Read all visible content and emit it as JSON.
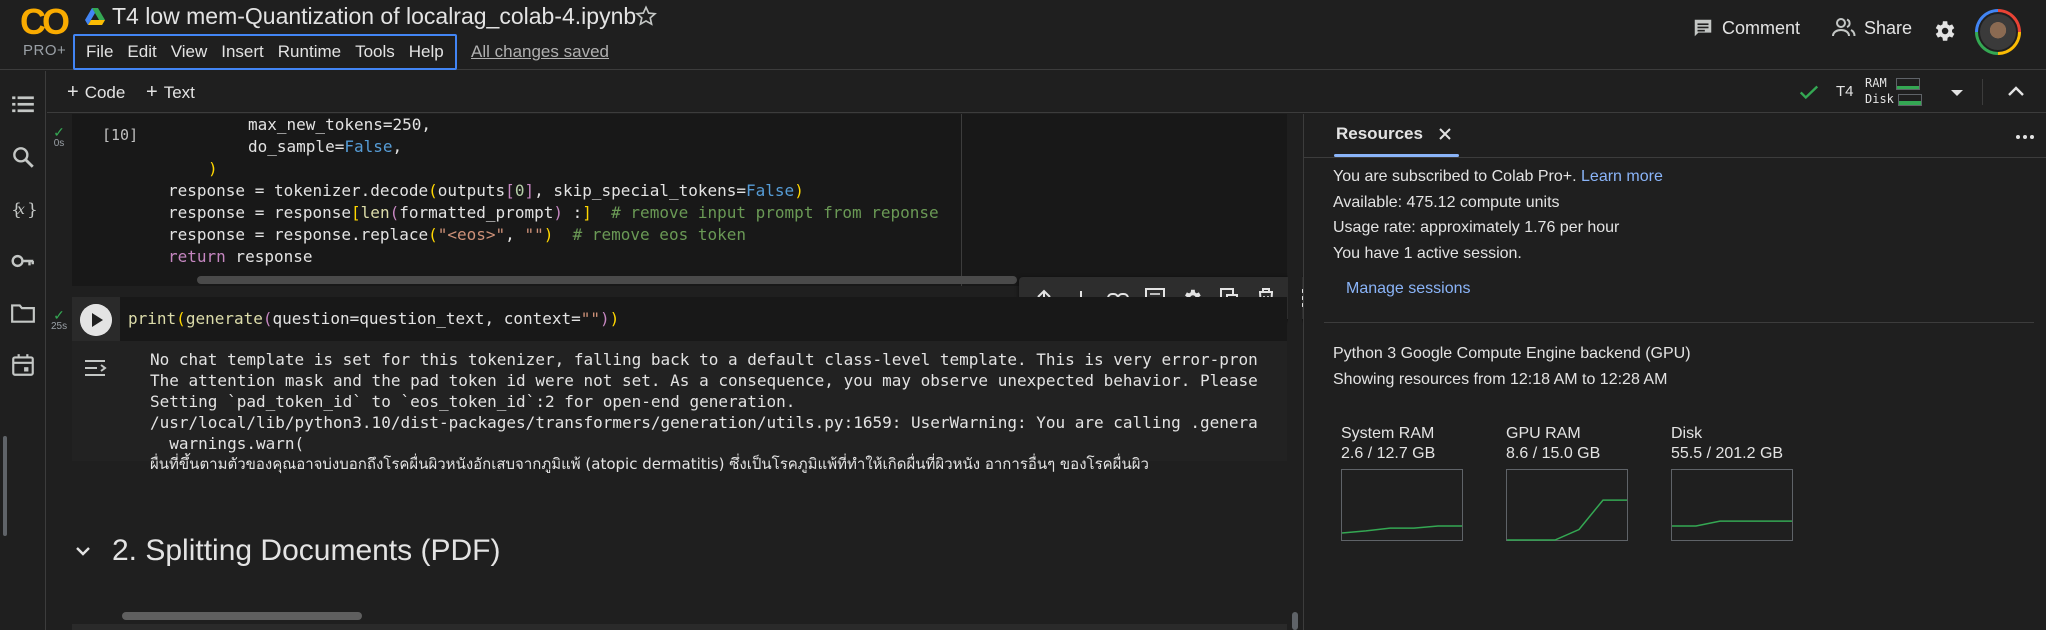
{
  "app": {
    "logo_text": "CO",
    "plan_badge": "PRO+",
    "title": "T4 low mem-Quantization of localrag_colab-4.ipynb",
    "save_status": "All changes saved"
  },
  "menu": [
    "File",
    "Edit",
    "View",
    "Insert",
    "Runtime",
    "Tools",
    "Help"
  ],
  "header_actions": {
    "comment": "Comment",
    "share": "Share"
  },
  "toolbar": {
    "add_code": "Code",
    "add_text": "Text",
    "gpu": "T4",
    "ram_label": "RAM",
    "disk_label": "Disk"
  },
  "cell1": {
    "exec_count": "[10]",
    "status_time": "0s",
    "lines": [
      "max_new_tokens=250,",
      "do_sample=False,",
      ")",
      "response = tokenizer.decode(outputs[0], skip_special_tokens=False)",
      "response = response[len(formatted_prompt) :]  # remove input prompt from reponse",
      "response = response.replace(\"<eos>\", \"\")  # remove eos token",
      "return response"
    ]
  },
  "cell2": {
    "status_time": "25s",
    "code": "print(generate(question=question_text, context=\"\"))",
    "output": [
      "No chat template is set for this tokenizer, falling back to a default class-level template. This is very error-pron",
      "The attention mask and the pad token id were not set. As a consequence, you may observe unexpected behavior. Please",
      "Setting `pad_token_id` to `eos_token_id`:2 for open-end generation.",
      "/usr/local/lib/python3.10/dist-packages/transformers/generation/utils.py:1659: UserWarning: You are calling .genera",
      "  warnings.warn(",
      "ผื่นที่ขึ้นตามตัวของคุณอาจบ่งบอกถึงโรคผื่นผิวหนังอักเสบจากภูมิแพ้ (atopic dermatitis) ซึ่งเป็นโรคภูมิแพ้ที่ทำให้เกิดผื่นที่ผิวหนัง อาการอื่นๆ ของโรคผื่นผิว"
    ]
  },
  "section": {
    "title": "2. Splitting Documents (PDF)"
  },
  "resources": {
    "tab_label": "Resources",
    "subscribed_text": "You are subscribed to Colab Pro+.",
    "learn_more": "Learn more",
    "available": "Available: 475.12 compute units",
    "usage_rate": "Usage rate: approximately 1.76 per hour",
    "sessions": "You have 1 active session.",
    "manage_sessions": "Manage sessions",
    "backend": "Python 3 Google Compute Engine backend (GPU)",
    "showing": "Showing resources from 12:18 AM to 12:28 AM",
    "gauges": [
      {
        "label": "System RAM",
        "value": "2.6 / 12.7 GB",
        "history": [
          0.1,
          0.13,
          0.17,
          0.17,
          0.2,
          0.2
        ],
        "color": "#34a853"
      },
      {
        "label": "GPU RAM",
        "value": "8.6 / 15.0 GB",
        "history": [
          0.0,
          0.0,
          0.0,
          0.15,
          0.57,
          0.57
        ],
        "color": "#34a853"
      },
      {
        "label": "Disk",
        "value": "55.5 / 201.2 GB",
        "history": [
          0.2,
          0.2,
          0.27,
          0.27,
          0.27,
          0.27
        ],
        "color": "#34a853"
      }
    ]
  },
  "colors": {
    "accent": "#8ab4f8",
    "success": "#34a853",
    "brand": "#f9ab00",
    "menu_focus": "#4285f4"
  }
}
